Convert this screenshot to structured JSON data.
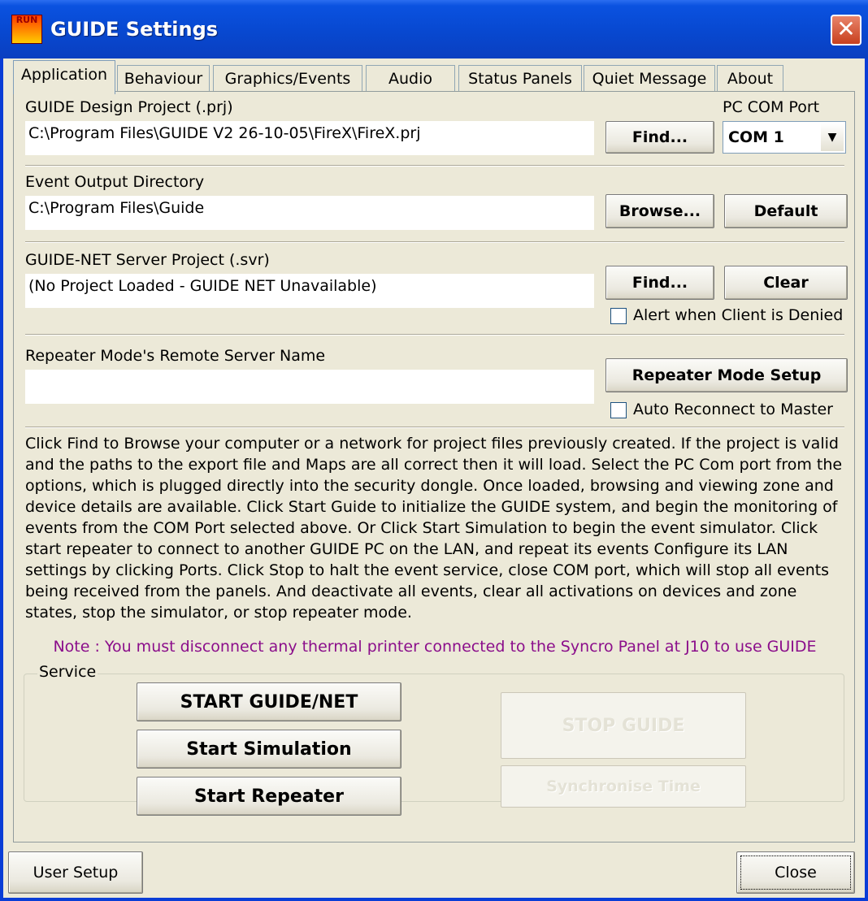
{
  "window": {
    "title": "GUIDE Settings",
    "icon_text": "RUN"
  },
  "tabs": [
    {
      "label": "Application",
      "active": true
    },
    {
      "label": "Behaviour"
    },
    {
      "label": "Graphics/Events"
    },
    {
      "label": "Audio"
    },
    {
      "label": "Status Panels"
    },
    {
      "label": "Quiet Message"
    },
    {
      "label": "About"
    }
  ],
  "design_project": {
    "label": "GUIDE Design Project (.prj)",
    "value": "C:\\Program Files\\GUIDE V2 26-10-05\\FireX\\FireX.prj",
    "find_label": "Find..."
  },
  "com_port": {
    "label": "PC COM Port",
    "selected": "COM 1"
  },
  "event_output": {
    "label": "Event Output Directory",
    "value": "C:\\Program Files\\Guide",
    "browse_label": "Browse...",
    "default_label": "Default"
  },
  "server_project": {
    "label": "GUIDE-NET Server Project (.svr)",
    "value": "(No Project Loaded - GUIDE NET Unavailable)",
    "find_label": "Find...",
    "clear_label": "Clear",
    "alert_label": "Alert when Client is Denied"
  },
  "repeater": {
    "label": "Repeater Mode's Remote Server Name",
    "value": "",
    "setup_label": "Repeater Mode Setup",
    "reconnect_label": "Auto Reconnect to Master"
  },
  "help_text": "Click Find to Browse your computer or a network for project files previously created. If the project is valid and the paths to the export file and Maps are all correct then it will load.  Select the PC Com port from the options, which is plugged directly into the security dongle. Once loaded, browsing and viewing zone and device details are available. Click Start Guide to initialize the GUIDE system, and begin the monitoring of events from the COM Port selected above. Or Click Start Simulation to begin the event simulator. Click start repeater to connect to another GUIDE PC on the LAN, and repeat its events Configure its LAN settings by clicking Ports. Click Stop to halt the event service, close COM port, which will stop all events being received from the panels. And deactivate all events, clear all activations on devices and zone states, stop the simulator, or stop repeater mode.",
  "note": "Note : You must disconnect any thermal printer connected to the Syncro Panel at J10 to use GUIDE",
  "service": {
    "legend": "Service",
    "start_guide": "START GUIDE/NET",
    "start_simulation": "Start Simulation",
    "start_repeater": "Start Repeater",
    "stop_guide": "STOP GUIDE",
    "sync_time": "Synchronise Time"
  },
  "footer": {
    "user_setup": "User Setup",
    "close": "Close"
  },
  "colors": {
    "note": "#8b0e8b",
    "titlebar": "#0a52e0",
    "dialog_bg": "#ece9d8"
  }
}
